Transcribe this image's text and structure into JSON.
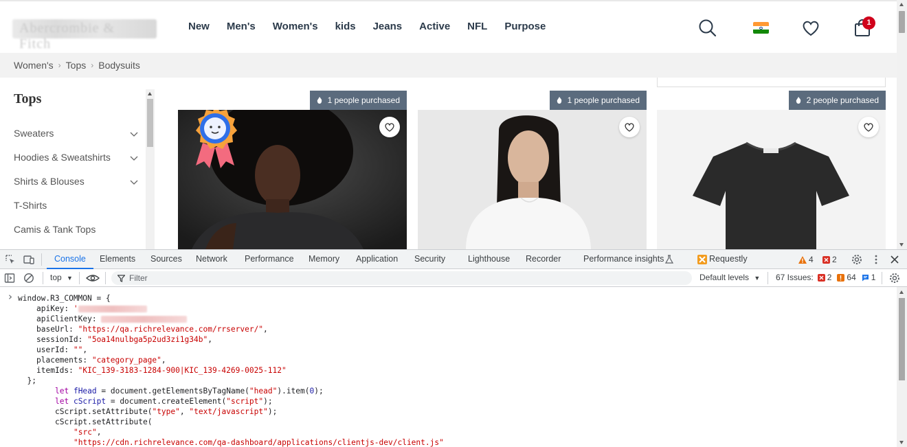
{
  "header": {
    "logo_text": "Abercrombie & Fitch",
    "nav": [
      "New",
      "Men's",
      "Women's",
      "kids",
      "Jeans",
      "Active",
      "NFL",
      "Purpose"
    ],
    "cart_count": "1"
  },
  "breadcrumb": [
    "Women's",
    "Tops",
    "Bodysuits"
  ],
  "sidebar": {
    "title": "Tops",
    "items": [
      {
        "label": "Sweaters",
        "expandable": true
      },
      {
        "label": "Hoodies & Sweatshirts",
        "expandable": true
      },
      {
        "label": "Shirts & Blouses",
        "expandable": true
      },
      {
        "label": "T-Shirts",
        "expandable": false
      },
      {
        "label": "Camis & Tank Tops",
        "expandable": false
      }
    ]
  },
  "products": [
    {
      "badge": "1 people purchased"
    },
    {
      "badge": "1 people purchased"
    },
    {
      "badge": "2 people purchased"
    }
  ],
  "devtools": {
    "tabs": [
      "Console",
      "Elements",
      "Sources",
      "Network",
      "Performance",
      "Memory",
      "Application",
      "Security",
      "Lighthouse",
      "Recorder",
      "Performance insights",
      "Requestly"
    ],
    "active_tab": "Console",
    "warnings": "4",
    "errors": "2",
    "context": "top",
    "filter_placeholder": "Filter",
    "levels": "Default levels",
    "issues_label": "67 Issues:",
    "issues_errors": "2",
    "issues_warnings": "64",
    "issues_info": "1",
    "colors": {
      "accent": "#1a73e8",
      "string": "#c80000",
      "keyword": "#a100a1",
      "variable": "#1a1aa6"
    }
  },
  "console": {
    "lines": [
      {
        "indent": 0,
        "parts": [
          {
            "t": "window.R3_COMMON = {",
            "c": "key"
          }
        ]
      },
      {
        "indent": 1,
        "parts": [
          {
            "t": "apiKey: ",
            "c": "key"
          },
          {
            "t": "'",
            "c": "str"
          },
          {
            "redact": 100
          }
        ]
      },
      {
        "indent": 1,
        "parts": [
          {
            "t": "apiClientKey: ",
            "c": "key"
          },
          {
            "redact": 125
          }
        ]
      },
      {
        "indent": 1,
        "parts": [
          {
            "t": "baseUrl: ",
            "c": "key"
          },
          {
            "t": "\"https://qa.richrelevance.com/rrserver/\"",
            "c": "str"
          },
          {
            "t": ",",
            "c": "key"
          }
        ]
      },
      {
        "indent": 1,
        "parts": [
          {
            "t": "sessionId: ",
            "c": "key"
          },
          {
            "t": "\"5oa14nulbga5p2ud3zi1g34b\"",
            "c": "str"
          },
          {
            "t": ",",
            "c": "key"
          }
        ]
      },
      {
        "indent": 1,
        "parts": [
          {
            "t": "userId: ",
            "c": "key"
          },
          {
            "t": "\"\"",
            "c": "str"
          },
          {
            "t": ",",
            "c": "key"
          }
        ]
      },
      {
        "indent": 1,
        "parts": [
          {
            "t": "placements: ",
            "c": "key"
          },
          {
            "t": "\"category_page\"",
            "c": "str"
          },
          {
            "t": ",",
            "c": "key"
          }
        ]
      },
      {
        "indent": 1,
        "parts": [
          {
            "t": "itemIds: ",
            "c": "key"
          },
          {
            "t": "\"KIC_139-3183-1284-900|KIC_139-4269-0025-112\"",
            "c": "str"
          }
        ]
      },
      {
        "indent": 0.5,
        "parts": [
          {
            "t": "};",
            "c": "key"
          }
        ]
      },
      {
        "indent": 2,
        "parts": [
          {
            "t": "let ",
            "c": "kw"
          },
          {
            "t": "fHead",
            "c": "var"
          },
          {
            "t": " = document.getElementsByTagName(",
            "c": "key"
          },
          {
            "t": "\"head\"",
            "c": "str"
          },
          {
            "t": ").item(",
            "c": "key"
          },
          {
            "t": "0",
            "c": "num"
          },
          {
            "t": ");",
            "c": "key"
          }
        ]
      },
      {
        "indent": 2,
        "parts": [
          {
            "t": "let ",
            "c": "kw"
          },
          {
            "t": "cScript",
            "c": "var"
          },
          {
            "t": " = document.createElement(",
            "c": "key"
          },
          {
            "t": "\"script\"",
            "c": "str"
          },
          {
            "t": ");",
            "c": "key"
          }
        ]
      },
      {
        "indent": 2,
        "parts": [
          {
            "t": "cScript.setAttribute(",
            "c": "key"
          },
          {
            "t": "\"type\"",
            "c": "str"
          },
          {
            "t": ", ",
            "c": "key"
          },
          {
            "t": "\"text/javascript\"",
            "c": "str"
          },
          {
            "t": ");",
            "c": "key"
          }
        ]
      },
      {
        "indent": 2,
        "parts": [
          {
            "t": "cScript.setAttribute(",
            "c": "key"
          }
        ]
      },
      {
        "indent": 3,
        "parts": [
          {
            "t": "\"src\"",
            "c": "str"
          },
          {
            "t": ",",
            "c": "key"
          }
        ]
      },
      {
        "indent": 3,
        "parts": [
          {
            "t": "\"https://cdn.richrelevance.com/qa-dashboard/applications/clientjs-dev/client.js\"",
            "c": "str"
          }
        ]
      }
    ]
  }
}
